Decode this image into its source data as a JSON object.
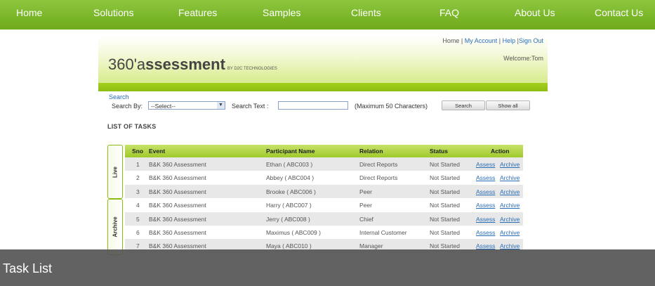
{
  "nav": {
    "items": [
      "Home",
      "Solutions",
      "Features",
      "Samples",
      "Clients",
      "FAQ",
      "About Us",
      "Contact Us"
    ]
  },
  "header": {
    "logo_main": "360'a",
    "logo_bold": "ssessment",
    "logo_sub": "BY D2C TECHNOLOGIES",
    "links": [
      "Home",
      "My Account",
      "Help",
      "Sign Out"
    ],
    "welcome": "Welcome:Tom"
  },
  "search": {
    "title": "Search",
    "search_by_label": "Search By:",
    "select_value": "--Select--",
    "search_text_label": "Search Text :",
    "search_text_value": "",
    "hint": "(Maximum 50 Characters)",
    "search_button": "Search",
    "show_all_button": "Show all"
  },
  "list_title": "LIST OF TASKS",
  "tabs": {
    "live": "Live",
    "archive": "Archive"
  },
  "table": {
    "headers": [
      "Sno",
      "Event",
      "Participant Name",
      "Relation",
      "Status",
      "Action"
    ],
    "rows": [
      {
        "sno": "1",
        "event": "B&K 360 Assessment",
        "participant": "Ethan ( ABC003 )",
        "relation": "Direct Reports",
        "status": "Not Started",
        "assess": "Assess",
        "archive": "Archive"
      },
      {
        "sno": "2",
        "event": "B&K 360 Assessment",
        "participant": "Abbey ( ABC004 )",
        "relation": "Direct Reports",
        "status": "Not Started",
        "assess": "Assess",
        "archive": "Archive"
      },
      {
        "sno": "3",
        "event": "B&K 360 Assessment",
        "participant": "Brooke ( ABC006 )",
        "relation": "Peer",
        "status": "Not Started",
        "assess": "Assess",
        "archive": "Archive"
      },
      {
        "sno": "4",
        "event": "B&K 360 Assessment",
        "participant": "Harry ( ABC007 )",
        "relation": "Peer",
        "status": "Not Started",
        "assess": "Assess",
        "archive": "Archive"
      },
      {
        "sno": "5",
        "event": "B&K 360 Assessment",
        "participant": "Jerry ( ABC008 )",
        "relation": "Chief",
        "status": "Not Started",
        "assess": "Assess",
        "archive": "Archive"
      },
      {
        "sno": "6",
        "event": "B&K 360 Assessment",
        "participant": "Maximus ( ABC009 )",
        "relation": "Internal Customer",
        "status": "Not Started",
        "assess": "Assess",
        "archive": "Archive"
      },
      {
        "sno": "7",
        "event": "B&K 360 Assessment",
        "participant": "Maya ( ABC010 )",
        "relation": "Manager",
        "status": "Not Started",
        "assess": "Assess",
        "archive": "Archive"
      }
    ]
  },
  "caption": "Task List",
  "colors": {
    "nav_green": "#7ab82a",
    "accent_green": "#9fca2a",
    "link_blue": "#2a6db7",
    "caption_bg": "#555555"
  }
}
